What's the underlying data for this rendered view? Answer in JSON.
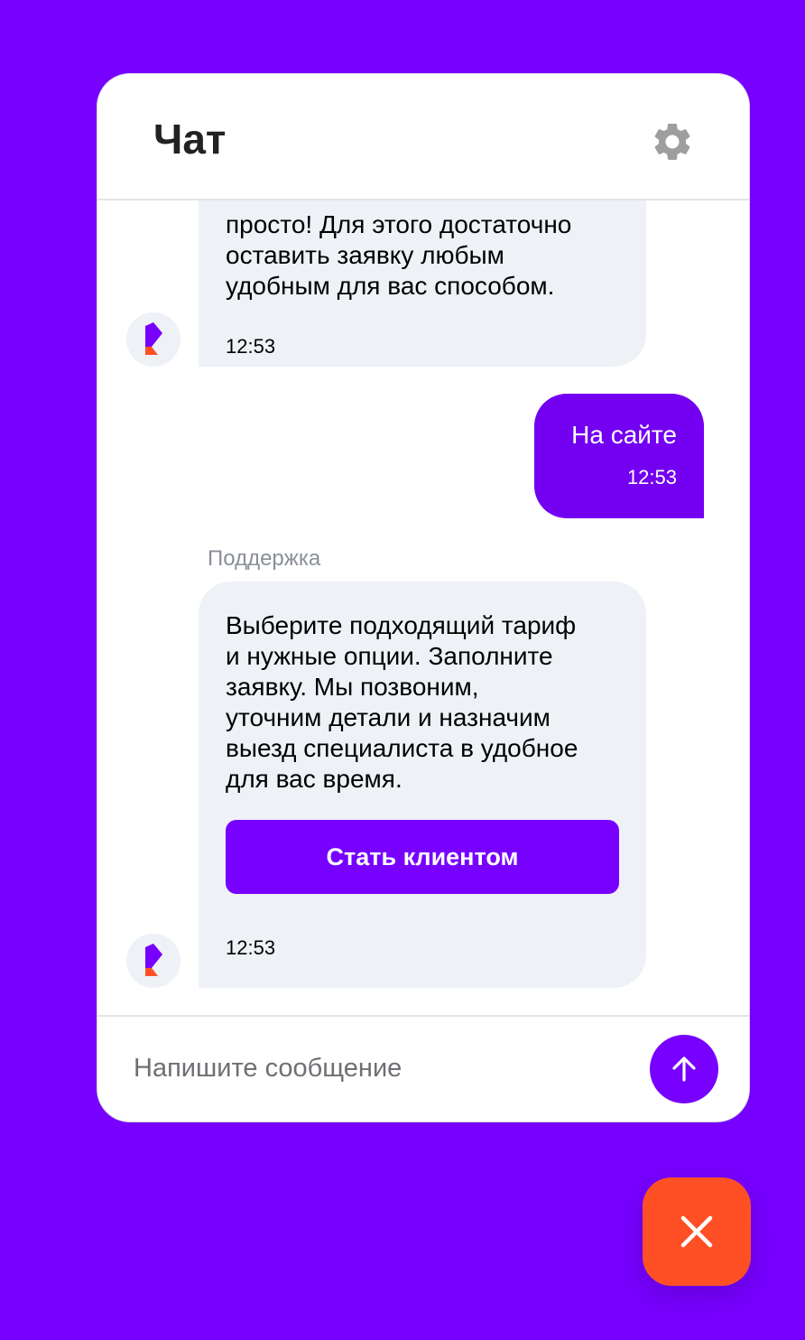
{
  "header": {
    "title": "Чат",
    "settings_icon": "gear-icon"
  },
  "messages": [
    {
      "from": "bot",
      "text": "просто! Для этого достаточно\nоставить заявку любым\nудобным для вас способом.",
      "time": "12:53"
    },
    {
      "from": "user",
      "text": "На сайте",
      "time": "12:53"
    },
    {
      "from": "bot",
      "sender": "Поддержка",
      "text": "Выберите подходящий тариф\nи нужные опции. Заполните\nзаявку. Мы позвоним,\nуточним детали и назначим\nвыезд специалиста в удобное\nдля вас время.",
      "button_label": "Стать клиентом",
      "time": "12:53"
    }
  ],
  "composer": {
    "placeholder": "Напишите сообщение",
    "value": "",
    "send_icon": "arrow-up-icon"
  },
  "fab": {
    "icon": "close-icon"
  },
  "colors": {
    "brand_purple": "#7700ff",
    "user_bubble": "#7300f0",
    "bot_bubble": "#eef1f6",
    "close_orange": "#ff5025"
  }
}
